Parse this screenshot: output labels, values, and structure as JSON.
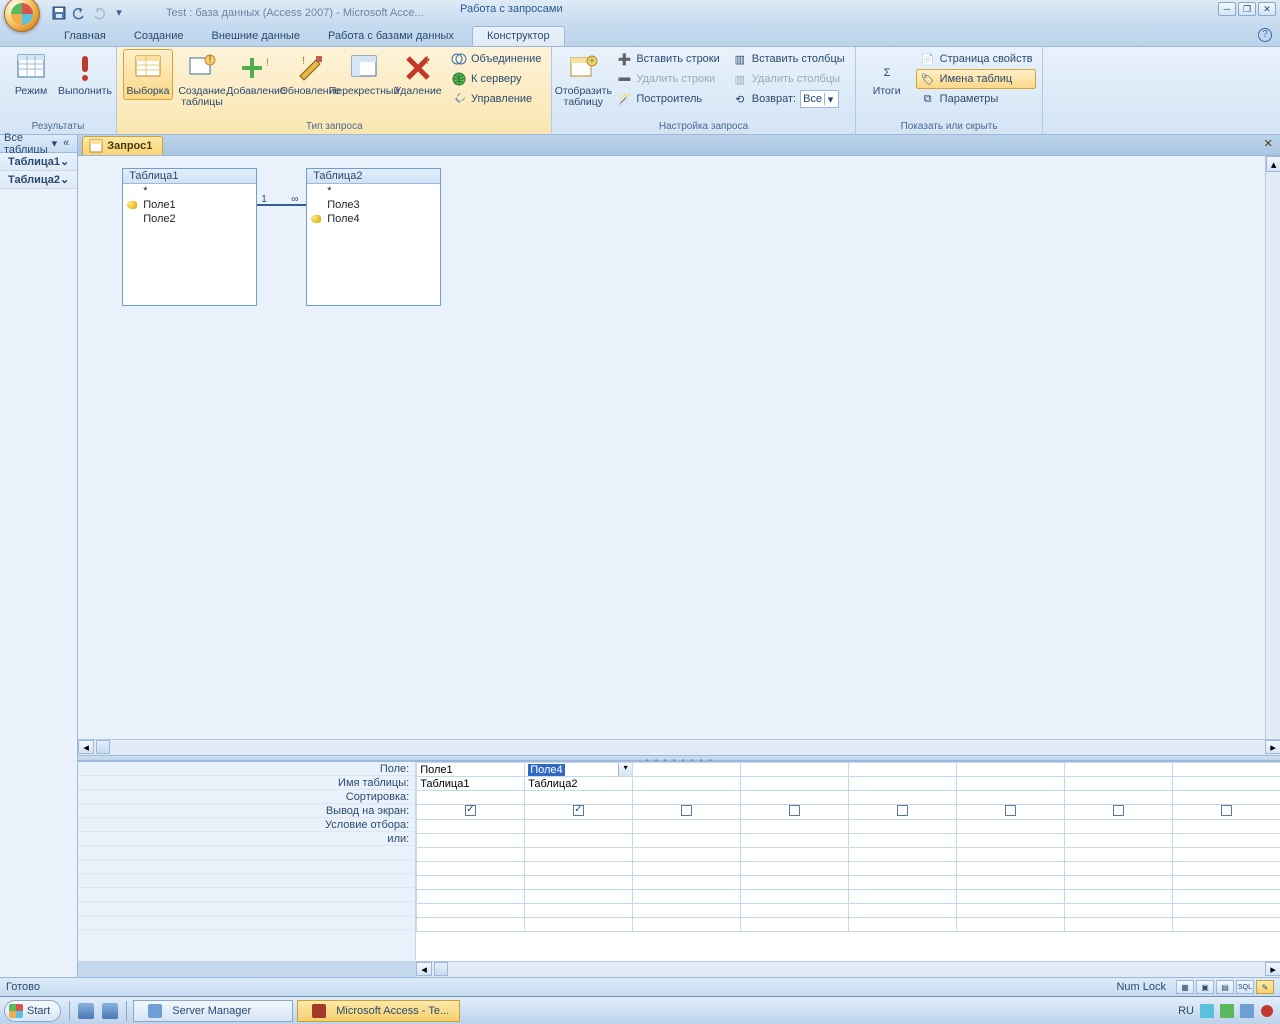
{
  "titlebar": {
    "title": "Test : база данных (Access 2007) - Microsoft Acce...",
    "context_title": "Работа с запросами"
  },
  "tabs": {
    "items": [
      "Главная",
      "Создание",
      "Внешние данные",
      "Работа с базами данных"
    ],
    "context": "Конструктор"
  },
  "ribbon": {
    "group_results": {
      "label": "Результаты",
      "mode": "Режим",
      "run": "Выполнить"
    },
    "group_querytype": {
      "label": "Тип запроса",
      "select": "Выборка",
      "maketable": "Создание таблицы",
      "append": "Добавление",
      "update": "Обновление",
      "crosstab": "Перекрестный",
      "delete": "Удаление",
      "union": "Объединение",
      "passthrough": "К серверу",
      "datadef": "Управление"
    },
    "group_show": {
      "showtable": "Отобразить таблицу"
    },
    "group_setup": {
      "label": "Настройка запроса",
      "insert_rows": "Вставить строки",
      "delete_rows": "Удалить строки",
      "builder": "Построитель",
      "insert_cols": "Вставить столбцы",
      "delete_cols": "Удалить столбцы",
      "return": "Возврат:",
      "return_val": "Все"
    },
    "group_totals": {
      "totals": "Итоги"
    },
    "group_showhide": {
      "label": "Показать или скрыть",
      "propsheet": "Страница свойств",
      "tablenames": "Имена таблиц",
      "parameters": "Параметры"
    }
  },
  "navpane": {
    "header": "Все таблицы",
    "group1": "Таблица1",
    "group2": "Таблица2"
  },
  "doctab": {
    "name": "Запрос1"
  },
  "tables": {
    "t1": {
      "title": "Таблица1",
      "star": "*",
      "f1": "Поле1",
      "f2": "Поле2"
    },
    "t2": {
      "title": "Таблица2",
      "star": "*",
      "f1": "Поле3",
      "f2": "Поле4"
    },
    "rel": {
      "left": "1",
      "right": "∞"
    }
  },
  "grid": {
    "labels": {
      "field": "Поле:",
      "table": "Имя таблицы:",
      "sort": "Сортировка:",
      "show": "Вывод на экран:",
      "criteria": "Условие отбора:",
      "or": "или:"
    },
    "col1": {
      "field": "Поле1",
      "table": "Таблица1"
    },
    "col2": {
      "field": "Поле4",
      "table": "Таблица2"
    }
  },
  "statusbar": {
    "ready": "Готово",
    "numlock": "Num Lock"
  },
  "taskbar": {
    "start": "Start",
    "task1": "Server Manager",
    "task2": "Microsoft Access - Te...",
    "lang": "RU"
  }
}
